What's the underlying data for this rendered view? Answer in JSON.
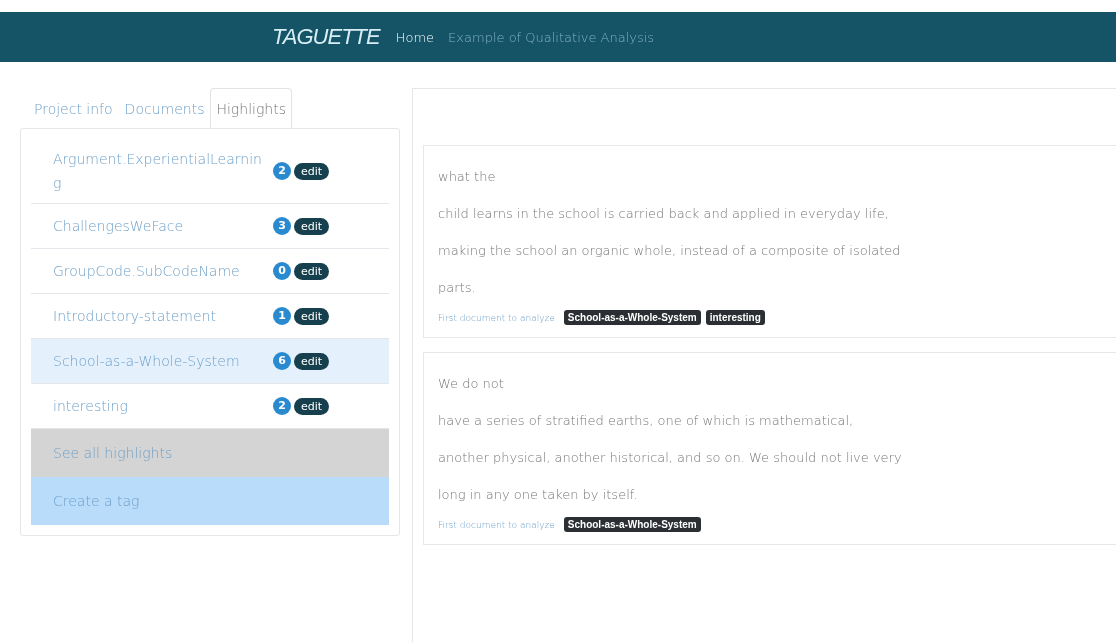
{
  "navbar": {
    "brand": "TAGUETTE",
    "links": [
      {
        "label": "Home",
        "selected": true
      },
      {
        "label": "Example of Qualitative Analysis",
        "selected": false
      }
    ]
  },
  "tabs": [
    {
      "label": "Project info",
      "selected": false
    },
    {
      "label": "Documents",
      "selected": false
    },
    {
      "label": "Highlights",
      "selected": true
    }
  ],
  "tags": [
    {
      "name": "Argument.ExperientialLearning",
      "count": "2",
      "button": "edit",
      "selected": false
    },
    {
      "name": "ChallengesWeFace",
      "count": "3",
      "button": "edit",
      "selected": false
    },
    {
      "name": "GroupCode.SubCodeName",
      "count": "0",
      "button": "edit",
      "selected": false
    },
    {
      "name": "Introductory-statement",
      "count": "1",
      "button": "edit",
      "selected": false
    },
    {
      "name": "School-as-a-Whole-System",
      "count": "6",
      "button": "edit",
      "selected": true
    },
    {
      "name": "interesting",
      "count": "2",
      "button": "edit",
      "selected": false
    }
  ],
  "actions": [
    {
      "label": "See all highlights",
      "kind": "secondary"
    },
    {
      "label": "Create a tag",
      "kind": "primary"
    }
  ],
  "highlights": [
    {
      "lines": [
        "what the",
        "child learns in the school is carried back and applied in everyday life,",
        "making the school an organic whole, instead of a composite of isolated",
        "parts."
      ],
      "document": "First document to analyze",
      "tags": [
        "School-as-a-Whole-System",
        "interesting"
      ]
    },
    {
      "lines": [
        "We do not",
        "have a series of stratified earths, one of which is mathematical,",
        "another physical, another historical, and so on. We should not live very",
        "long in any one taken by itself."
      ],
      "document": "First document to analyze",
      "tags": [
        "School-as-a-Whole-System"
      ]
    }
  ]
}
